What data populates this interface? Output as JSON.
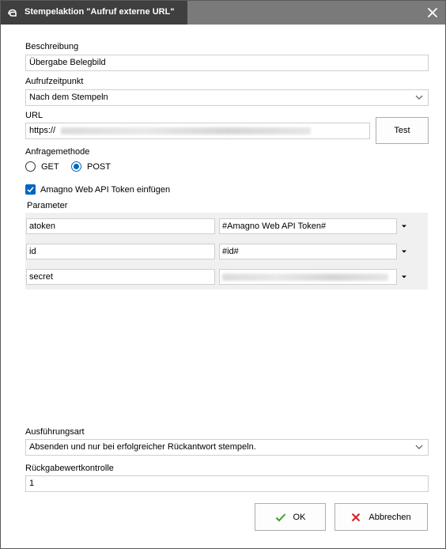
{
  "window": {
    "title": "Stempelaktion \"Aufruf externe URL\""
  },
  "form": {
    "beschreibung_label": "Beschreibung",
    "beschreibung_value": "Übergabe Belegbild",
    "aufrufzeitpunkt_label": "Aufrufzeitpunkt",
    "aufrufzeitpunkt_value": "Nach dem Stempeln",
    "url_label": "URL",
    "url_value": "https://",
    "test_button": "Test",
    "anfragemethode_label": "Anfragemethode",
    "method_get": "GET",
    "method_post": "POST",
    "selected_method": "POST",
    "token_checkbox_label": "Amagno Web API Token einfügen",
    "token_checked": true,
    "parameter_label": "Parameter",
    "parameters": [
      {
        "name": "atoken",
        "value": "#Amagno Web API Token#"
      },
      {
        "name": "id",
        "value": "#id#"
      },
      {
        "name": "secret",
        "value": ""
      }
    ],
    "ausfuehrungsart_label": "Ausführungsart",
    "ausfuehrungsart_value": "Absenden und nur bei erfolgreicher Rückantwort stempeln.",
    "rueckgabe_label": "Rückgabewertkontrolle",
    "rueckgabe_value": "1"
  },
  "footer": {
    "ok_button": "OK",
    "cancel_button": "Abbrechen"
  },
  "colors": {
    "accent": "#0067c0",
    "ok_green": "#3a9d2a",
    "cancel_red": "#d32020"
  }
}
